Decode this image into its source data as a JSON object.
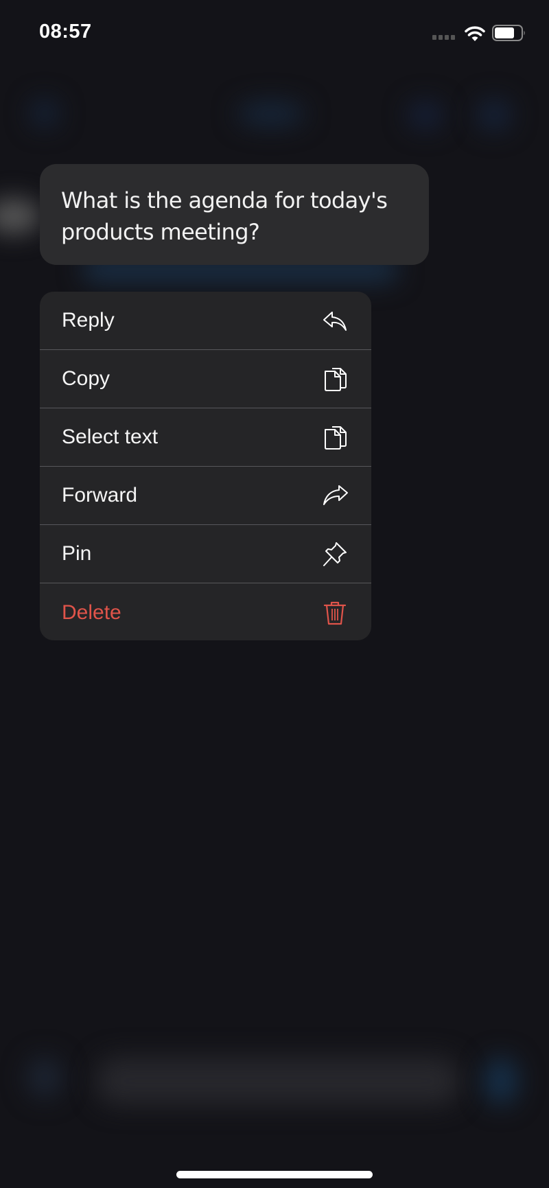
{
  "status_bar": {
    "time": "08:57",
    "signal_icon": "cellular-signal-icon",
    "wifi_icon": "wifi-icon",
    "battery_icon": "battery-icon"
  },
  "message": {
    "text": "What is the agenda for today's products meeting?"
  },
  "context_menu": {
    "items": [
      {
        "label": "Reply",
        "icon": "reply-icon",
        "destructive": false
      },
      {
        "label": "Copy",
        "icon": "copy-icon",
        "destructive": false
      },
      {
        "label": "Select text",
        "icon": "select-text-icon",
        "destructive": false
      },
      {
        "label": "Forward",
        "icon": "forward-icon",
        "destructive": false
      },
      {
        "label": "Pin",
        "icon": "pin-icon",
        "destructive": false
      },
      {
        "label": "Delete",
        "icon": "trash-icon",
        "destructive": true
      }
    ]
  },
  "colors": {
    "background": "#131318",
    "bubble": "#2c2c2e",
    "menu": "#252527",
    "destructive": "#e0544a",
    "accent_blur": "#1b3550"
  }
}
